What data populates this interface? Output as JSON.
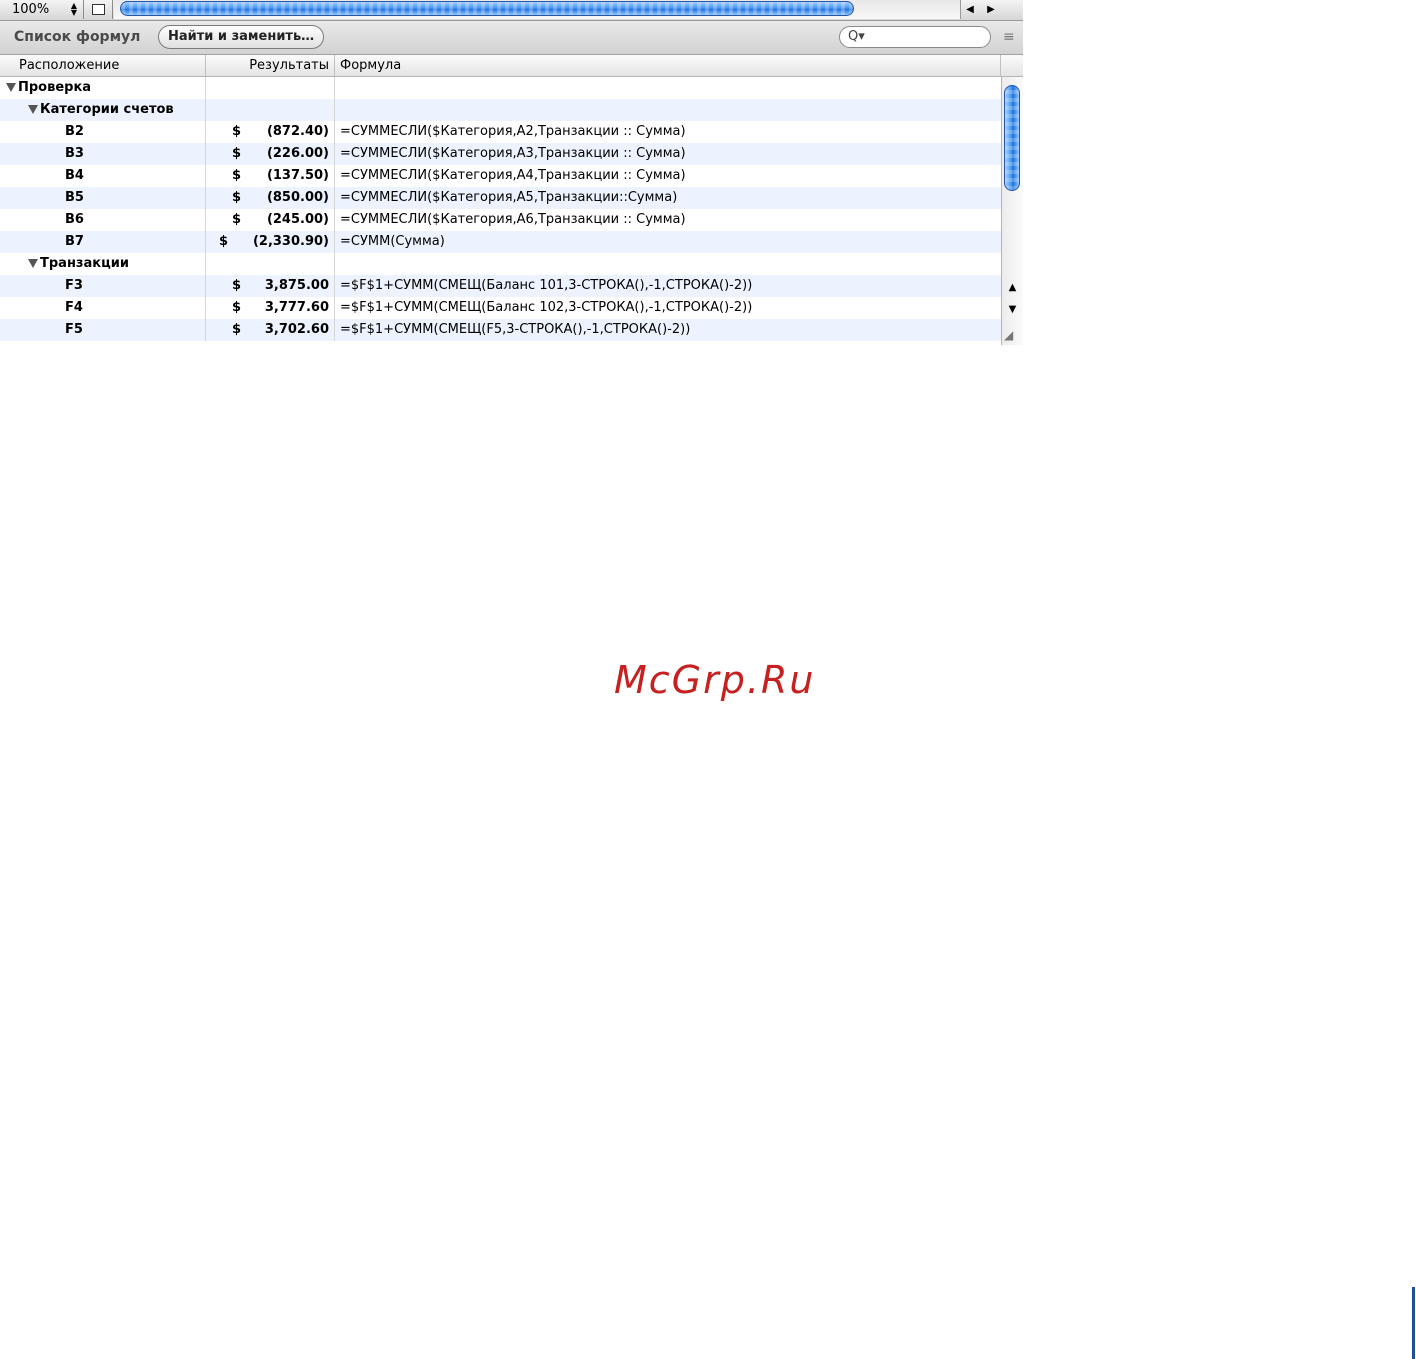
{
  "topbar": {
    "zoom": "100%",
    "arrow_left": "◀",
    "arrow_right": "▶"
  },
  "toolbar": {
    "title": "Список формул",
    "find_button": "Найти и заменить…",
    "search_icon": "Q▾",
    "menu_icon": "≡"
  },
  "columns": {
    "location": "Расположение",
    "results": "Результаты",
    "formula": "Формула"
  },
  "rows": [
    {
      "loc": "Проверка",
      "dollar": "",
      "amount": "",
      "formula": ""
    },
    {
      "loc": "Категории счетов",
      "dollar": "",
      "amount": "",
      "formula": ""
    },
    {
      "loc": "B2",
      "dollar": "$",
      "amount": "(872.40)",
      "formula": "=СУММЕСЛИ($Категория,A2,Транзакции :: Сумма)"
    },
    {
      "loc": "B3",
      "dollar": "$",
      "amount": "(226.00)",
      "formula": "=СУММЕСЛИ($Категория,A3,Транзакции :: Сумма)"
    },
    {
      "loc": "B4",
      "dollar": "$",
      "amount": "(137.50)",
      "formula": "=СУММЕСЛИ($Категория,A4,Транзакции :: Сумма)"
    },
    {
      "loc": "B5",
      "dollar": "$",
      "amount": "(850.00)",
      "formula": "=СУММЕСЛИ($Категория,A5,Транзакции::Сумма)"
    },
    {
      "loc": "B6",
      "dollar": "$",
      "amount": "(245.00)",
      "formula": "=СУММЕСЛИ($Категория,A6,Транзакции :: Сумма)"
    },
    {
      "loc": "B7",
      "dollar": "$",
      "amount": "(2,330.90)",
      "formula": "=СУММ(Сумма)"
    },
    {
      "loc": "Транзакции",
      "dollar": "",
      "amount": "",
      "formula": ""
    },
    {
      "loc": "F3",
      "dollar": "$",
      "amount": "3,875.00",
      "formula": "=$F$1+СУММ(СМЕЩ(Баланс 101,3-СТРОКА(),-1,СТРОКА()-2))"
    },
    {
      "loc": "F4",
      "dollar": "$",
      "amount": "3,777.60",
      "formula": "=$F$1+СУММ(СМЕЩ(Баланс 102,3-СТРОКА(),-1,СТРОКА()-2))"
    },
    {
      "loc": "F5",
      "dollar": "$",
      "amount": "3,702.60",
      "formula": "=$F$1+СУММ(СМЕЩ(F5,3-СТРОКА(),-1,СТРОКА()-2))"
    }
  ],
  "scrollbar": {
    "up": "▲",
    "down": "▼",
    "grip": "◢"
  },
  "watermark": "McGrp.Ru"
}
